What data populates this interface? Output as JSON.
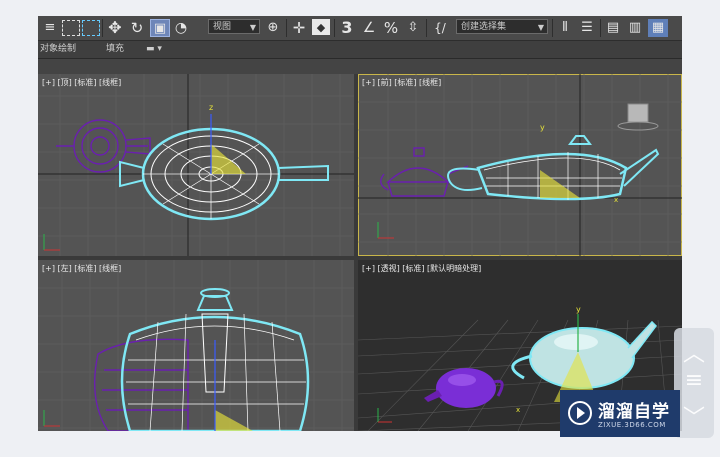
{
  "toolbar": {
    "viewport_dropdown": "视图",
    "selection_set_dropdown": "创建选择集",
    "icons": [
      "undo-icon",
      "select-region-icon",
      "window-crossing-icon",
      "move-icon",
      "rotate-icon",
      "scale-icon",
      "placement-icon",
      "reference-coordinate-dropdown",
      "pivot-icon",
      "select-manipulate-icon",
      "snap-3-icon",
      "angle-snap-icon",
      "percent-snap-icon",
      "spinner-snap-icon",
      "named-selection-icon",
      "mirror-icon",
      "align-icon",
      "scene-explorer-icon",
      "layer-explorer-icon",
      "ribbon-icon"
    ],
    "snap_label": "3"
  },
  "subbar": {
    "left_tab": "对象绘制",
    "fill_tab": "填充"
  },
  "viewports": {
    "top": {
      "label": "[+] [顶] [标准] [线框]"
    },
    "front": {
      "label": "[+] [前] [标准] [线框]"
    },
    "left": {
      "label": "[+] [左] [标准] [线框]"
    },
    "perspective": {
      "label": "[+] [透视] [标准] [默认明暗处理]"
    }
  },
  "axes": {
    "x": "x",
    "y": "y",
    "z": "z"
  },
  "colors": {
    "viewport_bg": "#545454",
    "grid": "#626262",
    "selected_wire": "#ffffff",
    "selection_outline": "#7fe8f5",
    "teapot_purple": "#6a1fb0",
    "gizmo_yellow": "#e6e23a",
    "active_border": "#c9b64a"
  },
  "watermark": {
    "title": "溜溜自学",
    "subtitle": "ZIXUE.3D66.COM"
  }
}
